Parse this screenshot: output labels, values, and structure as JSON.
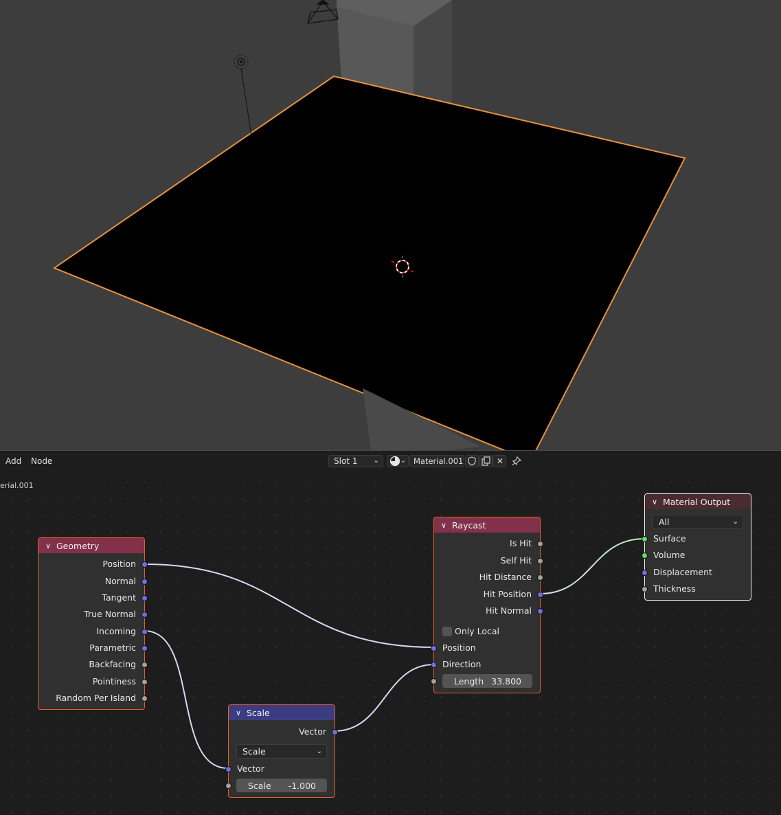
{
  "header": {
    "menu": [
      "Add",
      "Node"
    ],
    "slot": "Slot 1",
    "material_name": "Material.001",
    "breadcrumb": "erial.001",
    "icons": [
      "sphere-shading-icon",
      "shield-fake-user-icon",
      "duplicate-icon",
      "close-icon",
      "pin-icon"
    ]
  },
  "nodes": {
    "geometry": {
      "title": "Geometry",
      "outputs": [
        "Position",
        "Normal",
        "Tangent",
        "True Normal",
        "Incoming",
        "Parametric",
        "Backfacing",
        "Pointiness",
        "Random Per Island"
      ]
    },
    "raycast": {
      "title": "Raycast",
      "outputs": [
        "Is Hit",
        "Self Hit",
        "Hit Distance",
        "Hit Position",
        "Hit Normal"
      ],
      "only_local": "Only Local",
      "inputs": [
        "Position",
        "Direction"
      ],
      "length_label": "Length",
      "length_value": "33.800"
    },
    "scale": {
      "title": "Scale",
      "output": "Vector",
      "operation": "Scale",
      "input_vector": "Vector",
      "scale_label": "Scale",
      "scale_value": "-1.000"
    },
    "material_output": {
      "title": "Material Output",
      "target": "All",
      "inputs": [
        "Surface",
        "Volume",
        "Displacement",
        "Thickness"
      ]
    }
  },
  "colors": {
    "input_header": "#83314a",
    "converter_header": "#3c3c83",
    "output_header": "#4a2a33",
    "selection_orange": "#e2602a",
    "vector_socket": "#6f6fe0",
    "float_socket": "#a2a2a2",
    "shader_socket": "#64dc64"
  }
}
